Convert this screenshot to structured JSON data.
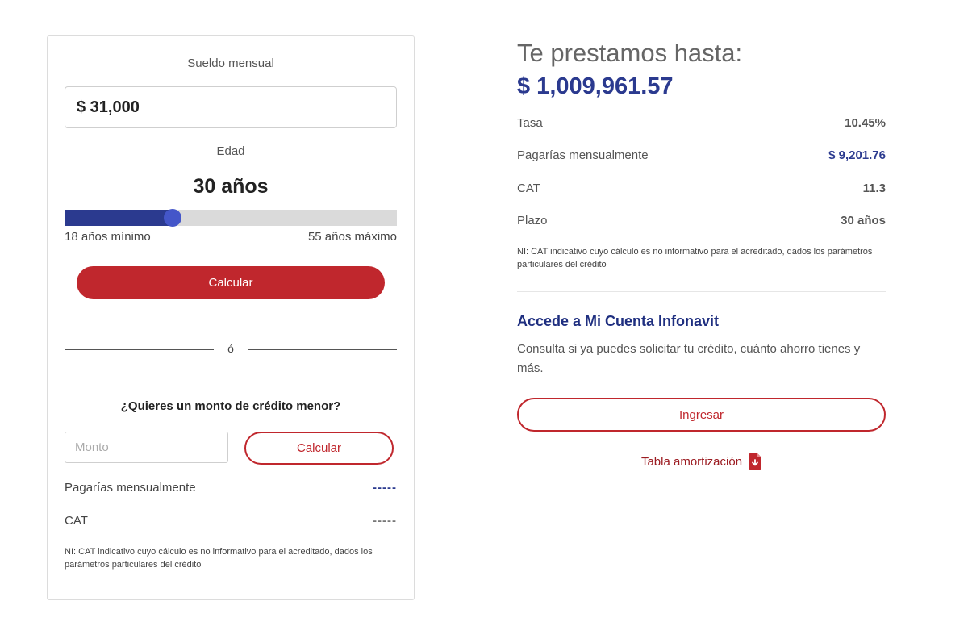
{
  "form": {
    "salary_label": "Sueldo mensual",
    "salary_value": "$ 31,000",
    "age_label": "Edad",
    "age_value": "30 años",
    "age_slider": {
      "min": 18,
      "max": 55,
      "value": 30
    },
    "slider_min_label": "18 años mínimo",
    "slider_max_label": "55 años máximo",
    "calculate_label": "Calcular",
    "or_label": "ó",
    "smaller_question": "¿Quieres un monto de crédito menor?",
    "amount_placeholder": "Monto",
    "amount_value": "",
    "calculate2_label": "Calcular",
    "monthly_label": "Pagarías mensualmente",
    "monthly_value": "-----",
    "cat_label": "CAT",
    "cat_value": "-----",
    "note": "NI: CAT indicativo cuyo cálculo es no informativo para el acreditado, dados los parámetros particulares del crédito"
  },
  "result": {
    "title": "Te prestamos hasta:",
    "amount": "$ 1,009,961.57",
    "rows": [
      {
        "label": "Tasa",
        "value": "10.45%"
      },
      {
        "label": "Pagarías mensualmente",
        "value": "$ 9,201.76"
      },
      {
        "label": "CAT",
        "value": "11.3"
      },
      {
        "label": "Plazo",
        "value": "30 años"
      }
    ],
    "note": "NI: CAT indicativo cuyo cálculo es no informativo para el acreditado, dados los parámetros particulares del crédito",
    "account_heading": "Accede a Mi Cuenta Infonavit",
    "account_desc": "Consulta si ya puedes solicitar tu crédito, cuánto ahorro tienes y más.",
    "login_label": "Ingresar",
    "amortization_label": "Tabla amortización",
    "amortization_icon": "pdf-download-icon"
  },
  "colors": {
    "brand_red": "#c0272d",
    "brand_blue": "#2b3a8f"
  }
}
